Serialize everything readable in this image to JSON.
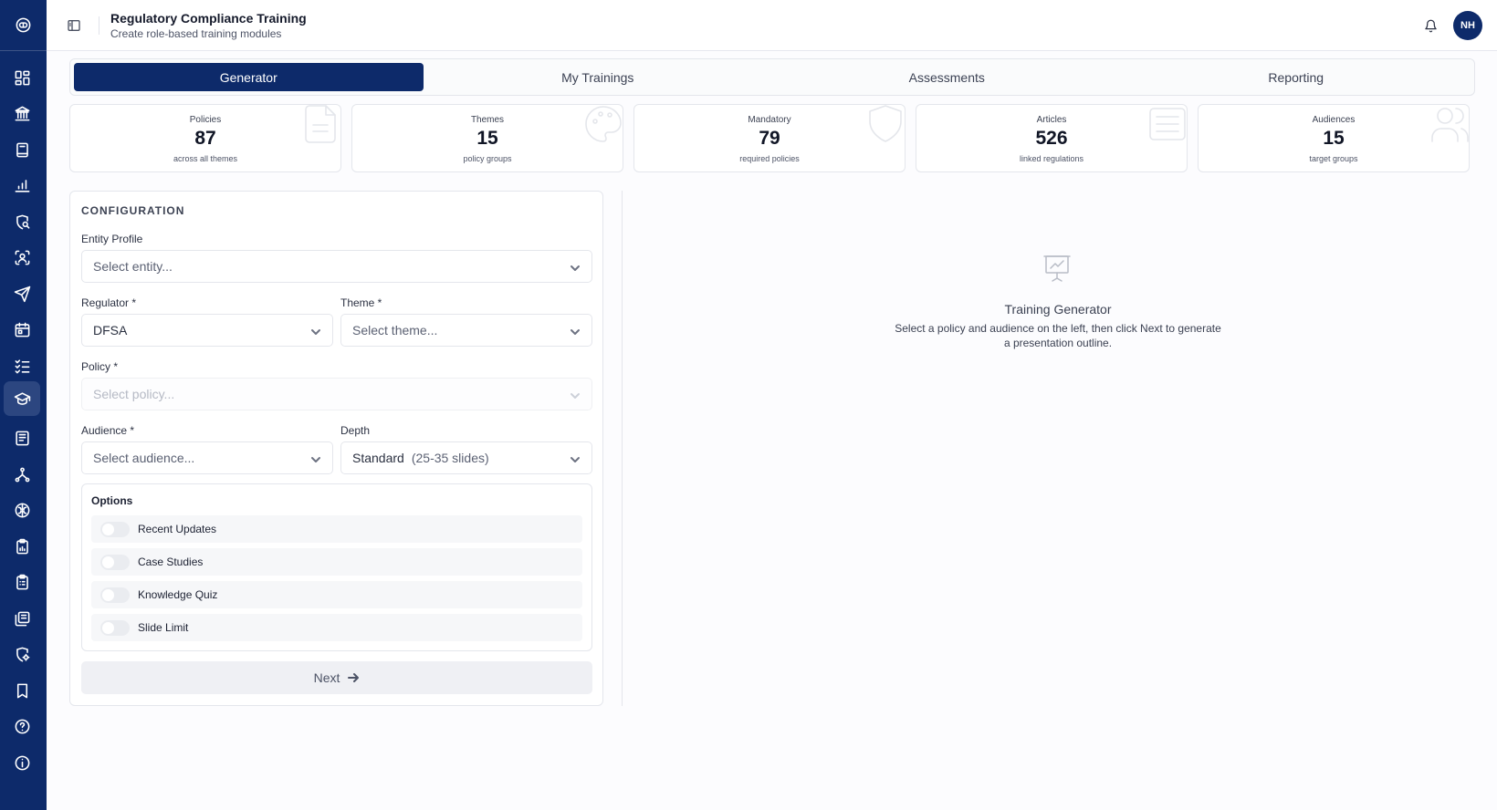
{
  "header": {
    "title": "Regulatory Compliance Training",
    "subtitle": "Create role-based training modules",
    "avatar_initials": "NH"
  },
  "sidebar": {
    "items": [
      {
        "icon": "grid-icon"
      },
      {
        "icon": "bank-icon"
      },
      {
        "icon": "book-icon"
      },
      {
        "icon": "chart-icon"
      },
      {
        "icon": "shield-search-icon"
      },
      {
        "icon": "scan-user-icon"
      },
      {
        "icon": "send-icon"
      },
      {
        "icon": "calendar-icon"
      },
      {
        "icon": "checklist-icon"
      },
      {
        "icon": "graduation-cap-icon",
        "active": true
      },
      {
        "icon": "newspaper-icon"
      },
      {
        "icon": "network-icon"
      },
      {
        "icon": "brain-icon"
      },
      {
        "icon": "clipboard-chart-icon"
      },
      {
        "icon": "clipboard-list-icon"
      },
      {
        "icon": "library-icon"
      },
      {
        "icon": "shield-gear-icon"
      },
      {
        "icon": "bookmark-icon"
      },
      {
        "icon": "help-icon"
      },
      {
        "icon": "info-icon"
      }
    ]
  },
  "tabs": [
    {
      "label": "Generator",
      "active": true
    },
    {
      "label": "My Trainings"
    },
    {
      "label": "Assessments"
    },
    {
      "label": "Reporting"
    }
  ],
  "stats": [
    {
      "label": "Policies",
      "value": "87",
      "sub": "across all themes",
      "icon": "file-icon"
    },
    {
      "label": "Themes",
      "value": "15",
      "sub": "policy groups",
      "icon": "palette-icon"
    },
    {
      "label": "Mandatory",
      "value": "79",
      "sub": "required policies",
      "icon": "shield-icon"
    },
    {
      "label": "Articles",
      "value": "526",
      "sub": "linked regulations",
      "icon": "list-icon"
    },
    {
      "label": "Audiences",
      "value": "15",
      "sub": "target groups",
      "icon": "users-icon"
    }
  ],
  "config": {
    "title": "CONFIGURATION",
    "entity_label": "Entity Profile",
    "entity_value": "Select entity...",
    "regulator_label": "Regulator *",
    "regulator_value": "DFSA",
    "theme_label": "Theme *",
    "theme_value": "Select theme...",
    "policy_label": "Policy *",
    "policy_value": "Select policy...",
    "audience_label": "Audience *",
    "audience_value": "Select audience...",
    "depth_label": "Depth",
    "depth_value": "Standard",
    "depth_detail": "(25-35 slides)",
    "options_title": "Options",
    "options": [
      {
        "label": "Recent Updates",
        "on": false
      },
      {
        "label": "Case Studies",
        "on": false
      },
      {
        "label": "Knowledge Quiz",
        "on": false
      },
      {
        "label": "Slide Limit",
        "on": false
      }
    ],
    "next_label": "Next"
  },
  "empty_state": {
    "title": "Training Generator",
    "text": "Select a policy and audience on the left, then click Next to generate a presentation outline."
  },
  "colors": {
    "primary": "#0d2a6a",
    "sidebar_active": "#2c4680",
    "border": "#e4e6ec"
  }
}
